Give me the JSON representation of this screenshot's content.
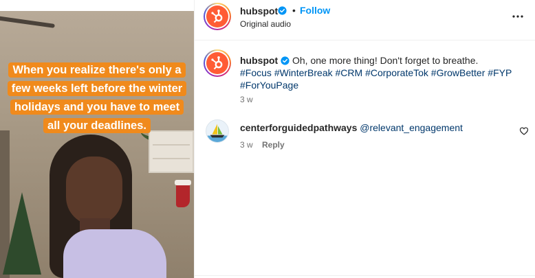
{
  "media": {
    "caption": "When you realize there's only a few weeks left before the winter holidays and you have to meet all your deadlines."
  },
  "header": {
    "username": "hubspot",
    "separator": "•",
    "follow_label": "Follow",
    "audio_label": "Original audio",
    "more_icon": "more-horizontal-icon"
  },
  "post": {
    "username": "hubspot",
    "text": "Oh, one more thing! Don't forget to breathe.",
    "hashtags": [
      "#Focus",
      "#WinterBreak",
      "#CRM",
      "#CorporateTok",
      "#GrowBetter",
      "#FYP",
      "#ForYouPage"
    ],
    "time": "3 w"
  },
  "comments": [
    {
      "username": "centerforguidedpathways",
      "mention": "@relevant_engagement",
      "time": "3 w",
      "reply_label": "Reply",
      "like_icon": "heart-icon"
    }
  ],
  "colors": {
    "brand": "#ff5c35",
    "follow": "#0095f6",
    "hashtag": "#00376b",
    "verified": "#0095f6",
    "caption_bg": "#f08a1c"
  }
}
